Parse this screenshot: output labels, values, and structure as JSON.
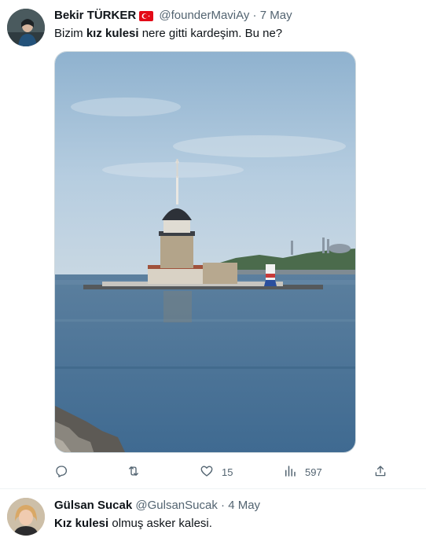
{
  "tweets": [
    {
      "author_name": "Bekir TÜRKER",
      "author_badge": "turkey-flag-icon",
      "handle": "@founderMaviAy",
      "separator": "·",
      "date": "7 May",
      "text_parts": [
        "Bizim ",
        "kız kulesi",
        " nere gitti kardeşim. Bu ne?"
      ],
      "media_alt": "Photo of Maiden's Tower (Kız Kulesi) in the Bosphorus",
      "actions": {
        "reply": {
          "icon": "reply-icon",
          "count": ""
        },
        "retweet": {
          "icon": "retweet-icon",
          "count": ""
        },
        "like": {
          "icon": "heart-icon",
          "count": "15"
        },
        "views": {
          "icon": "views-chart-icon",
          "count": "597"
        },
        "share": {
          "icon": "share-icon",
          "count": ""
        }
      }
    },
    {
      "author_name": "Gülsan Sucak",
      "handle": "@GulsanSucak",
      "separator": "·",
      "date": "4 May",
      "text_parts": [
        "Kız kulesi",
        " olmuş asker kalesi."
      ]
    }
  ],
  "colors": {
    "text_primary": "#0f1419",
    "text_secondary": "#536471",
    "divider": "#eff3f4",
    "flag_red": "#e30a17"
  }
}
